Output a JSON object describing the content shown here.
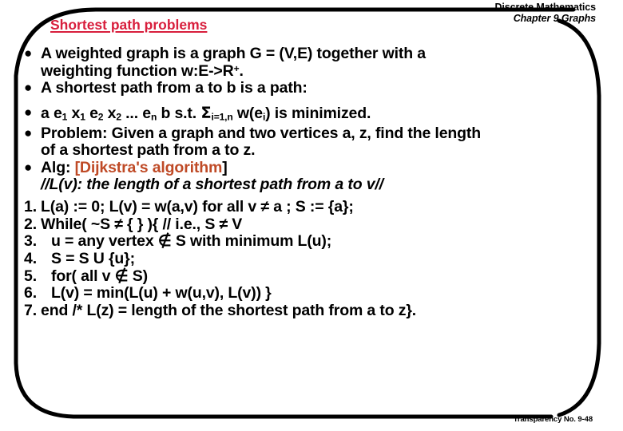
{
  "header": {
    "course_title": "Discrete Mathematics",
    "chapter": "Chapter 9 Graphs",
    "slide_title": "Shortest path problems"
  },
  "colors": {
    "title_red": "#D81E3C",
    "accent_orange": "#BF4A26",
    "text_black": "#000000",
    "background": "#FFFFFF"
  },
  "body": {
    "bullet_glyph": "●",
    "bullets": [
      {
        "id": "weighted-graph-def",
        "line1": "A weighted graph is a graph G = (V,E) together with a",
        "line2_pre": "weighting function w:E->R",
        "line2_sup": "+",
        "line2_post": "."
      },
      {
        "id": "shortest-path-def",
        "line1": "A shortest path from a to b is a path:"
      },
      {
        "id": "minimization-formula",
        "prefix": " a e",
        "sub1": "1",
        "mid1": " x",
        "sub2": "1",
        "mid2": " e",
        "sub3": "2",
        "mid3": " x",
        "sub4": "2",
        "mid4": " ... e",
        "sub5": "n",
        "mid5": " b s.t. ",
        "sigma": "Σ",
        "sigma_sub": "i=1,n",
        "mid6": " w(e",
        "sub6": "i",
        "suffix": ") is minimized."
      },
      {
        "id": "problem-statement",
        "line1": "Problem: Given a graph and two vertices a, z, find the length",
        "line2": "of a shortest path from a to z."
      },
      {
        "id": "algorithm-name",
        "label": "Alg: ",
        "bracket_open": "[",
        "accent_text": "Dijkstra's algorithm",
        "bracket_close": "]"
      }
    ],
    "comment_line": "//L(v): the length of a shortest path from a to v//",
    "steps": [
      {
        "num": "1.",
        "text": "L(a) := 0;  L(v) = w(a,v) for all v ≠ a ; S := {a};",
        "wide": false
      },
      {
        "num": "2.",
        "text": "While( ~S ≠ { } ){ // i.e., S ≠ V",
        "wide": false
      },
      {
        "num": "3.",
        "text": "u = any vertex ∉ S with minimum L(u);",
        "wide": true
      },
      {
        "num": "4.",
        "text": "S = S U {u};",
        "wide": true
      },
      {
        "num": "5.",
        "text": "for( all v ∉ S)",
        "wide": true
      },
      {
        "num": "6.",
        "text": "L(v) = min(L(u) + w(u,v), L(v))   }",
        "wide": true
      },
      {
        "num": "7.",
        "text": "end /* L(z) = length of the shortest path from a to z}.",
        "wide": false
      }
    ]
  },
  "footer": {
    "transparency": "Transparency No. 9-48"
  }
}
